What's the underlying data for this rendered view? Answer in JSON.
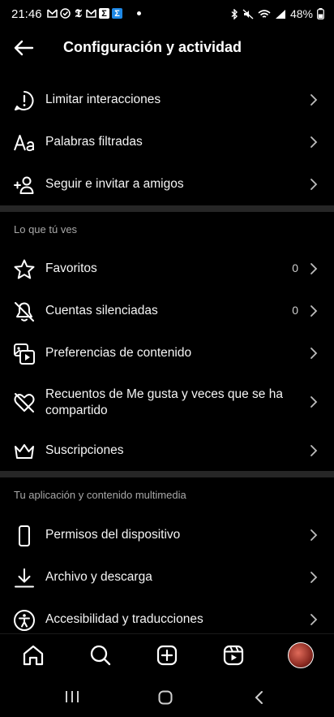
{
  "status_bar": {
    "time": "21:46",
    "notifications": [
      "gmail-icon",
      "check-icon",
      "nyt-icon",
      "gmail-icon",
      "sigma-icon",
      "sigma-blue-icon"
    ],
    "battery": "48%"
  },
  "header": {
    "title": "Configuración y actividad"
  },
  "groups": {
    "top": [
      {
        "label": "Limitar interacciones",
        "icon": "alert-circle-icon"
      },
      {
        "label": "Palabras filtradas",
        "icon": "text-aa-icon"
      },
      {
        "label": "Seguir e invitar a amigos",
        "icon": "add-person-icon"
      }
    ],
    "what_you_see": {
      "title": "Lo que tú ves",
      "items": [
        {
          "label": "Favoritos",
          "count": "0",
          "icon": "star-icon"
        },
        {
          "label": "Cuentas silenciadas",
          "count": "0",
          "icon": "bell-off-icon"
        },
        {
          "label": "Preferencias de contenido",
          "icon": "media-icon"
        },
        {
          "label": "Recuentos de Me gusta y veces que se ha compartido",
          "icon": "heart-off-icon"
        },
        {
          "label": "Suscripciones",
          "icon": "crown-icon"
        }
      ]
    },
    "app_media": {
      "title": "Tu aplicación y contenido multimedia",
      "items": [
        {
          "label": "Permisos del dispositivo",
          "icon": "phone-icon"
        },
        {
          "label": "Archivo y descarga",
          "icon": "download-icon"
        },
        {
          "label": "Accesibilidad y traducciones",
          "icon": "accessibility-icon"
        }
      ]
    }
  },
  "bottom_nav": [
    "home-icon",
    "search-icon",
    "create-icon",
    "reels-icon",
    "profile-avatar"
  ],
  "system_nav": [
    "recents-icon",
    "home-circle-icon",
    "back-icon"
  ]
}
